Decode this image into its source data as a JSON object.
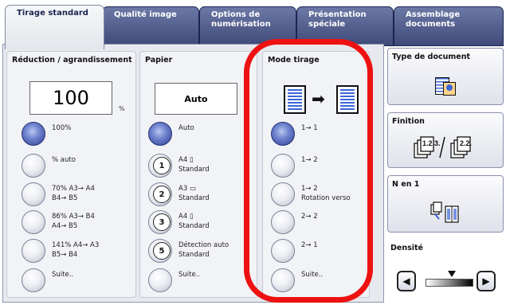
{
  "tabs": [
    {
      "label_line1": "Tirage standard",
      "label_line2": ""
    },
    {
      "label_line1": "Qualité image",
      "label_line2": ""
    },
    {
      "label_line1": "Options de",
      "label_line2": "numérisation"
    },
    {
      "label_line1": "Présentation",
      "label_line2": "spéciale"
    },
    {
      "label_line1": "Assemblage",
      "label_line2": "documents"
    }
  ],
  "reduction": {
    "title": "Réduction / agrandissement",
    "value": "100",
    "unit": "%",
    "options": [
      {
        "line1": "100%",
        "line2": "",
        "selected": true
      },
      {
        "line1": "% auto",
        "line2": "",
        "selected": false
      },
      {
        "line1": "70% A3→ A4",
        "line2": "B4→ B5",
        "selected": false
      },
      {
        "line1": "86% A3→ B4",
        "line2": "A4→ B5",
        "selected": false
      },
      {
        "line1": "141% A4→ A3",
        "line2": "B5→ B4",
        "selected": false
      },
      {
        "line1": "Suite..",
        "line2": "",
        "selected": false
      }
    ]
  },
  "paper": {
    "title": "Papier",
    "value": "Auto",
    "options": [
      {
        "badge": "",
        "line1": "Auto",
        "line2": "",
        "selected": true
      },
      {
        "badge": "1",
        "line1": "A4 ▯",
        "line2": "Standard",
        "selected": false
      },
      {
        "badge": "2",
        "line1": "A3 ▭",
        "line2": "Standard",
        "selected": false
      },
      {
        "badge": "3",
        "line1": "A4 ▯",
        "line2": "Standard",
        "selected": false
      },
      {
        "badge": "5",
        "line1": "Détection auto",
        "line2": "Standard",
        "selected": false
      },
      {
        "badge": "",
        "line1": "Suite..",
        "line2": "",
        "selected": false
      }
    ]
  },
  "mode": {
    "title": "Mode tirage",
    "options": [
      {
        "line1": "1→ 1",
        "line2": "",
        "selected": true
      },
      {
        "line1": "1→ 2",
        "line2": "",
        "selected": false
      },
      {
        "line1": "1→ 2",
        "line2": "Rotation verso",
        "selected": false
      },
      {
        "line1": "2→ 2",
        "line2": "",
        "selected": false
      },
      {
        "line1": "2→ 1",
        "line2": "",
        "selected": false
      },
      {
        "line1": "Suite..",
        "line2": "",
        "selected": false
      }
    ]
  },
  "right": {
    "document_type": "Type de document",
    "finishing": "Finition",
    "n_up": "N en 1",
    "density": "Densité",
    "density_level": 0.55
  },
  "icons": {
    "arrow_right": "➡",
    "left": "◀",
    "right": "▶"
  }
}
